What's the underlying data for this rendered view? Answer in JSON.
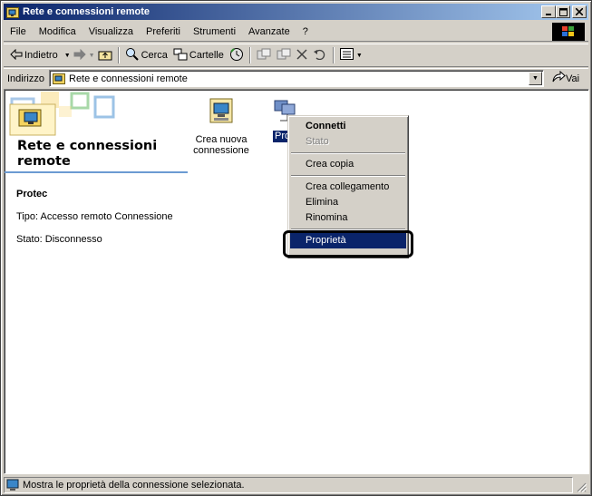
{
  "window": {
    "title": "Rete e connessioni remote"
  },
  "menu": {
    "items": [
      "File",
      "Modifica",
      "Visualizza",
      "Preferiti",
      "Strumenti",
      "Avanzate",
      "?"
    ]
  },
  "toolbar": {
    "back_label": "Indietro",
    "search_label": "Cerca",
    "folders_label": "Cartelle"
  },
  "address": {
    "label": "Indirizzo",
    "value": "Rete e connessioni remote",
    "go_label": "Vai"
  },
  "panel": {
    "title": "Rete e connessioni remote",
    "name": "Protec",
    "type": "Tipo: Accesso remoto Connessione",
    "state": "Stato: Disconnesso"
  },
  "icons": [
    {
      "label": "Crea nuova connessione"
    },
    {
      "label": "Protec"
    }
  ],
  "context_menu": {
    "items": [
      "Connetti",
      "Stato",
      "Crea copia",
      "Crea collegamento",
      "Elimina",
      "Rinomina",
      "Proprietà"
    ]
  },
  "status": {
    "text": "Mostra le proprietà della connessione selezionata."
  },
  "colors": {
    "titlebar": "#0a246a",
    "selection": "#0a246a",
    "face": "#d4d0c8"
  }
}
